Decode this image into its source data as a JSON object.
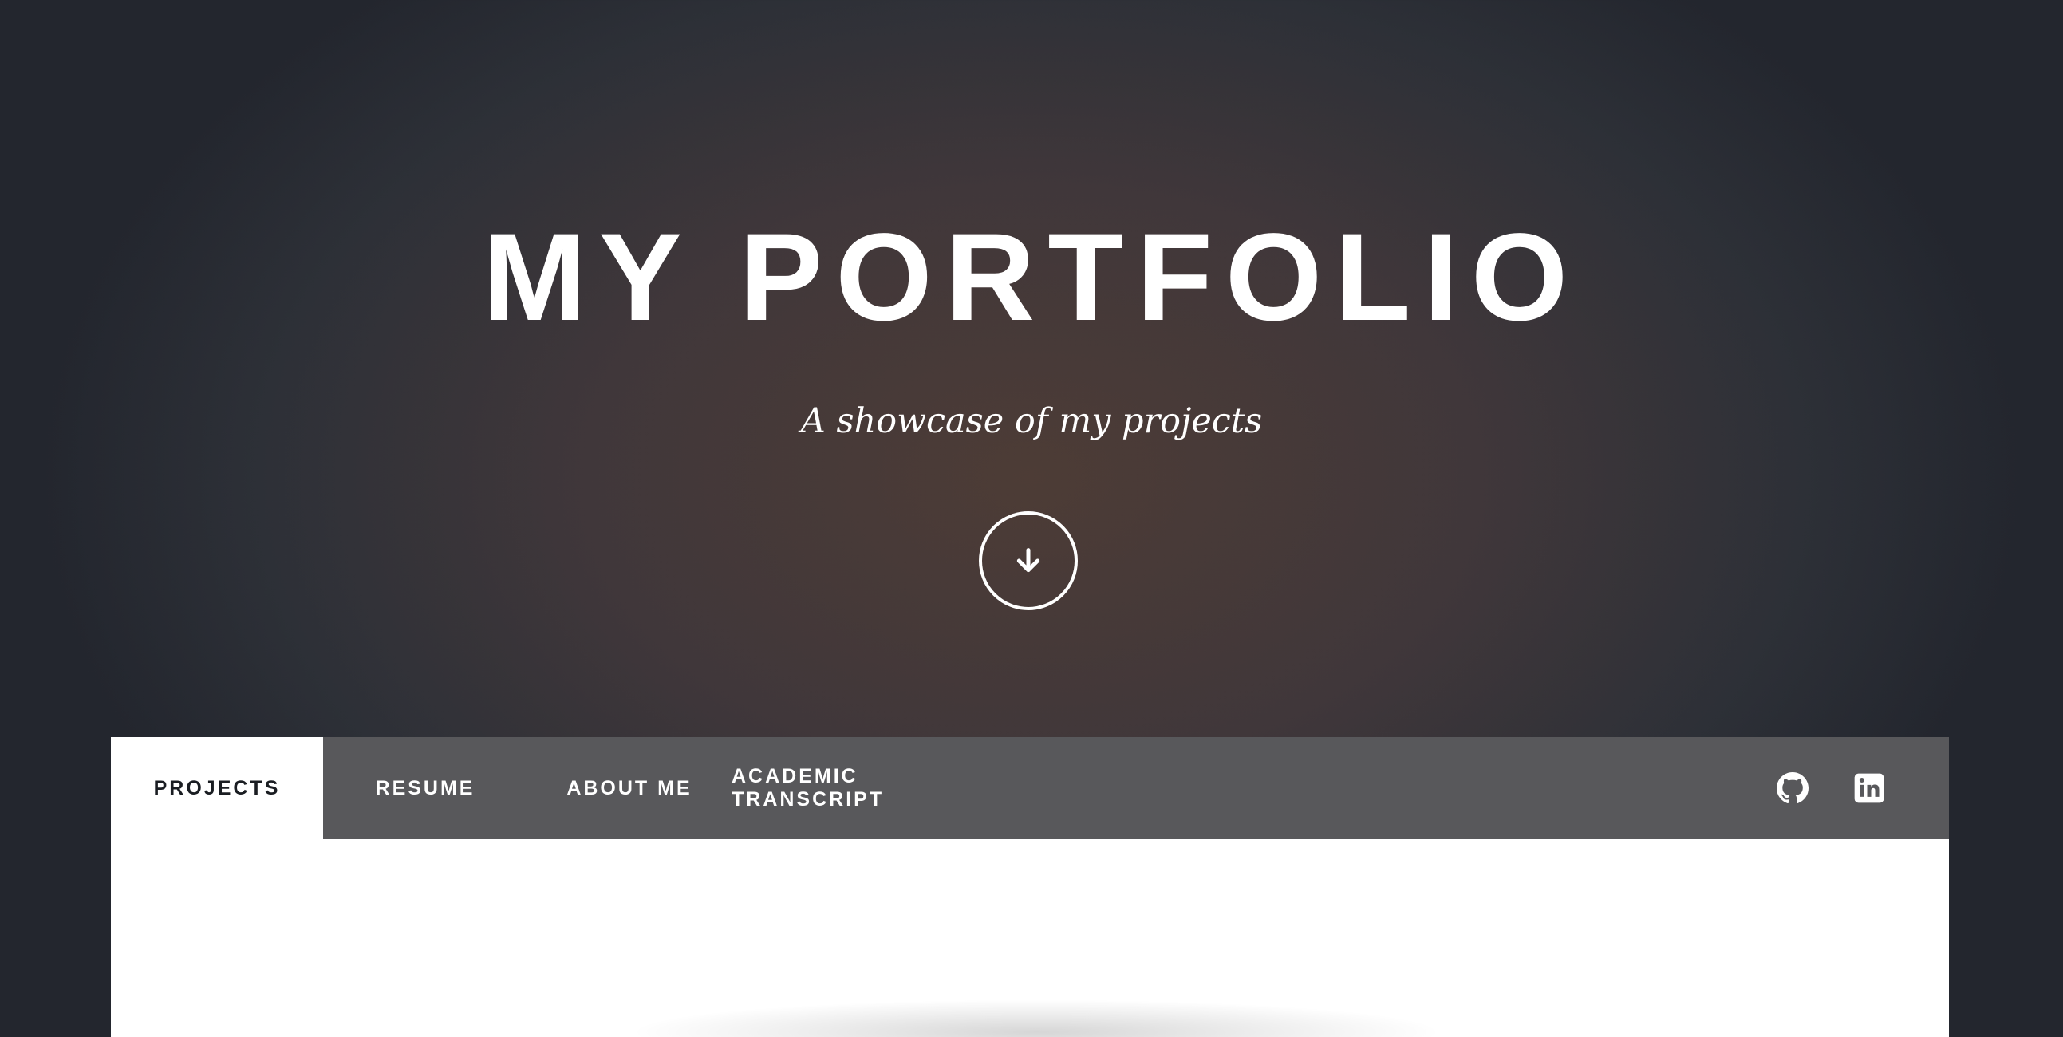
{
  "hero": {
    "title": "MY PORTFOLIO",
    "subtitle": "A showcase of my projects",
    "scroll_icon": "arrow-down-icon"
  },
  "nav": {
    "tabs": [
      {
        "label": "PROJECTS",
        "active": true
      },
      {
        "label": "RESUME",
        "active": false
      },
      {
        "label": "ABOUT ME",
        "active": false
      },
      {
        "label": "ACADEMIC TRANSCRIPT",
        "active": false
      }
    ],
    "social": [
      {
        "icon": "github-icon"
      },
      {
        "icon": "linkedin-icon"
      }
    ]
  },
  "colors": {
    "hero_background": "#3f3838",
    "navbar": "#58585b",
    "active_tab": "#ffffff",
    "active_tab_text": "#1a1d22",
    "text": "#ffffff"
  }
}
